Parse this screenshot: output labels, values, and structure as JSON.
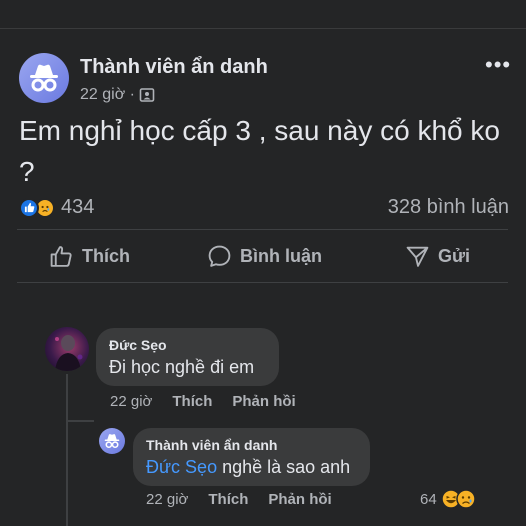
{
  "post": {
    "author": "Thành viên ẩn danh",
    "time": "22 giờ ·",
    "text": "Em nghỉ học cấp 3 , sau này có khổ ko ?",
    "reaction_count": "434",
    "comment_count": "328 bình luận",
    "more_label": "•••"
  },
  "actions": {
    "like": "Thích",
    "comment": "Bình luận",
    "share": "Gửi"
  },
  "comments": [
    {
      "author": "Đức Sẹo",
      "text": "Đi học nghề đi em",
      "time": "22 giờ",
      "like": "Thích",
      "reply": "Phản hồi"
    }
  ],
  "reply": {
    "author": "Thành viên ẩn danh",
    "mention": "Đức Sẹo",
    "text": " nghề là sao anh",
    "time": "22 giờ",
    "like": "Thích",
    "reply": "Phản hồi",
    "reaction_count": "64"
  },
  "colors": {
    "background": "#242526",
    "bubble": "#3a3b3c",
    "mention": "#4599ff",
    "like_blue": "#1b74e4",
    "avatar_purple": "#7f8ce8"
  }
}
